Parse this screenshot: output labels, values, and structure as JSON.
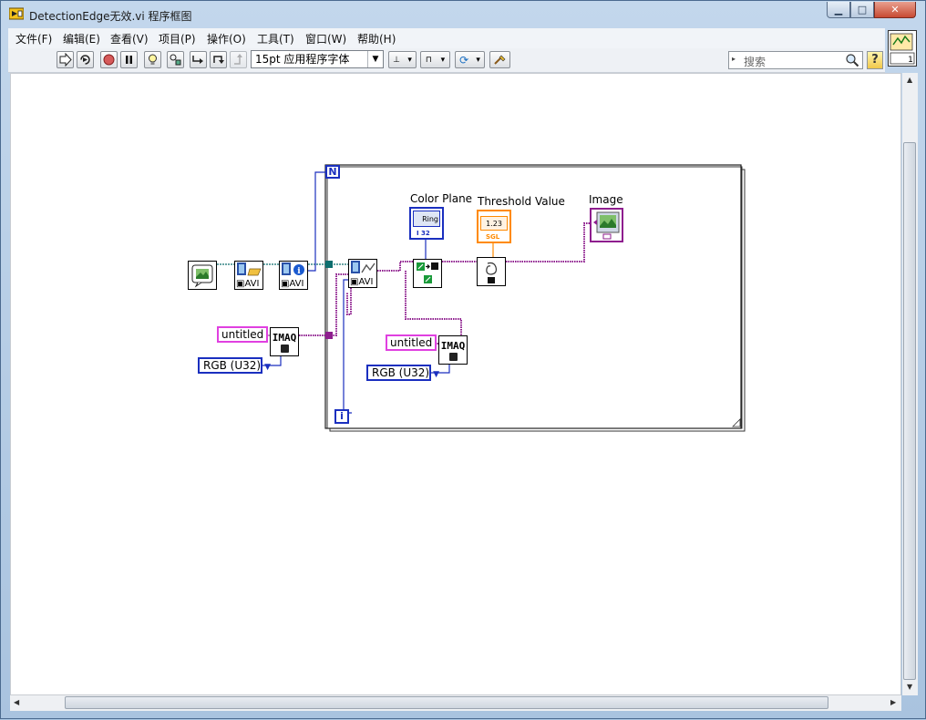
{
  "window": {
    "title": "DetectionEdge无效.vi 程序框图",
    "controls": {
      "minimize": "▁",
      "maximize": "□",
      "close": "✕"
    }
  },
  "menu": [
    "文件(F)",
    "编辑(E)",
    "查看(V)",
    "项目(P)",
    "操作(O)",
    "工具(T)",
    "窗口(W)",
    "帮助(H)"
  ],
  "toolbar": {
    "font": "15pt 应用程序字体",
    "search_placeholder": "搜索",
    "help_label": "?",
    "connector_number": "1"
  },
  "diagram": {
    "loop_count_label": "N",
    "loop_iteration_label": "i",
    "labels": {
      "color_plane": "Color Plane",
      "threshold_value": "Threshold Value",
      "image": "Image"
    },
    "constants": {
      "untitled_1": "untitled",
      "untitled_2": "untitled",
      "rgb_1": "RGB (U32)",
      "rgb_2": "RGB (U32)"
    },
    "node_text": {
      "imaq": "IMAQ",
      "avi": "AVI",
      "ring": "Ring",
      "ring_type": "I 32",
      "numeric": "1.23",
      "numeric_type": "SGL"
    }
  },
  "colors": {
    "image_wire": "#8e1e8e",
    "refnum_wire": "#0d6e6e",
    "int_wire": "#1a2fbf",
    "float_wire": "#ff8a00",
    "string_border": "#e040e0"
  }
}
